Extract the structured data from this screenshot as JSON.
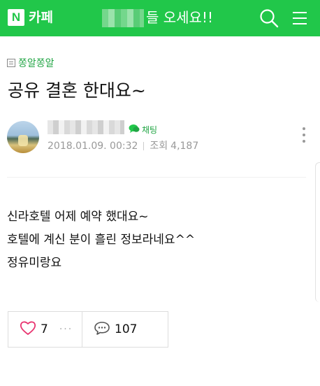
{
  "header": {
    "logo": "N",
    "cafe_label": "카페",
    "title": "들 오세요!!"
  },
  "post": {
    "board": "쫑알쫑알",
    "title": "공유 결혼 한대요~",
    "chat_label": "채팅",
    "date": "2018.01.09. 00:32",
    "views_label": "조회",
    "views": "4,187",
    "body": [
      "신라호텔 어제 예약 했대요~",
      "호텔에 계신 분이 흘린 정보라네요^^",
      "정유미랑요"
    ]
  },
  "reactions": {
    "likes": "7",
    "more": "···",
    "comments": "107"
  },
  "colors": {
    "brand_green": "#21c74a",
    "link_green": "#21a544",
    "like_pink": "#e8336f"
  },
  "icons": [
    "search-icon",
    "menu-icon",
    "board-icon",
    "chat-icon",
    "more-vertical-icon",
    "heart-icon",
    "comment-icon"
  ]
}
